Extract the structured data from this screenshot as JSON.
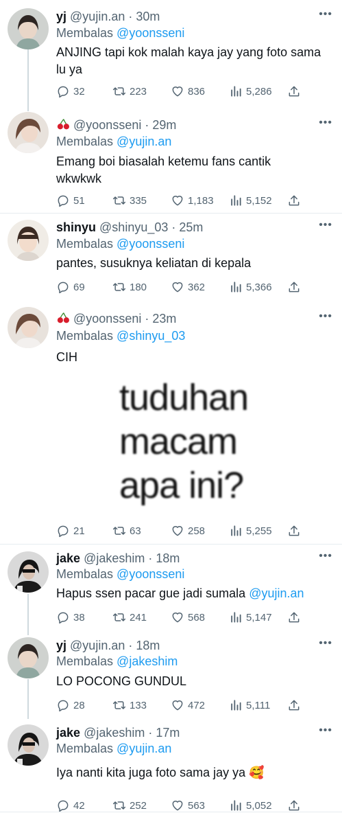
{
  "tweets": [
    {
      "name": "yj",
      "handle": "@yujin.an",
      "time": "30m",
      "reply_prefix": "Membalas",
      "reply_to": "@yoonsseni",
      "text": "ANJING tapi kok malah kaya jay yang foto sama lu ya",
      "replies": "32",
      "retweets": "223",
      "likes": "836",
      "views": "5,286"
    },
    {
      "name": "🍒",
      "handle": "@yoonsseni",
      "time": "29m",
      "reply_prefix": "Membalas",
      "reply_to": "@yujin.an",
      "text": "Emang boi biasalah ketemu fans cantik wkwkwk",
      "replies": "51",
      "retweets": "335",
      "likes": "1,183",
      "views": "5,152"
    },
    {
      "name": "shinyu",
      "handle": "@shinyu_03",
      "time": "25m",
      "reply_prefix": "Membalas",
      "reply_to": "@yoonsseni",
      "text": "pantes, susuknya keliatan di kepala",
      "replies": "69",
      "retweets": "180",
      "likes": "362",
      "views": "5,366"
    },
    {
      "name": "🍒",
      "handle": "@yoonsseni",
      "time": "23m",
      "reply_prefix": "Membalas",
      "reply_to": "@shinyu_03",
      "text": "CIH",
      "meme_lines": [
        "tuduhan",
        "macam",
        "apa  ini?"
      ],
      "replies": "21",
      "retweets": "63",
      "likes": "258",
      "views": "5,255"
    },
    {
      "name": "jake",
      "handle": "@jakeshim",
      "time": "18m",
      "reply_prefix": "Membalas",
      "reply_to": "@yoonsseni",
      "text": "Hapus ssen pacar gue jadi sumala",
      "text_mention": "@yujin.an",
      "replies": "38",
      "retweets": "241",
      "likes": "568",
      "views": "5,147"
    },
    {
      "name": "yj",
      "handle": "@yujin.an",
      "time": "18m",
      "reply_prefix": "Membalas",
      "reply_to": "@jakeshim",
      "text": "LO POCONG GUNDUL",
      "replies": "28",
      "retweets": "133",
      "likes": "472",
      "views": "5,111"
    },
    {
      "name": "jake",
      "handle": "@jakeshim",
      "time": "17m",
      "reply_prefix": "Membalas",
      "reply_to": "@yujin.an",
      "text": "Iya nanti kita juga foto sama jay ya",
      "text_emoji": "🥰",
      "replies": "42",
      "retweets": "252",
      "likes": "563",
      "views": "5,052"
    }
  ],
  "separator": "·",
  "colors": {
    "link": "#1d9bf0",
    "muted": "#536471",
    "text": "#0f1419",
    "divider": "#e6ecf0"
  }
}
